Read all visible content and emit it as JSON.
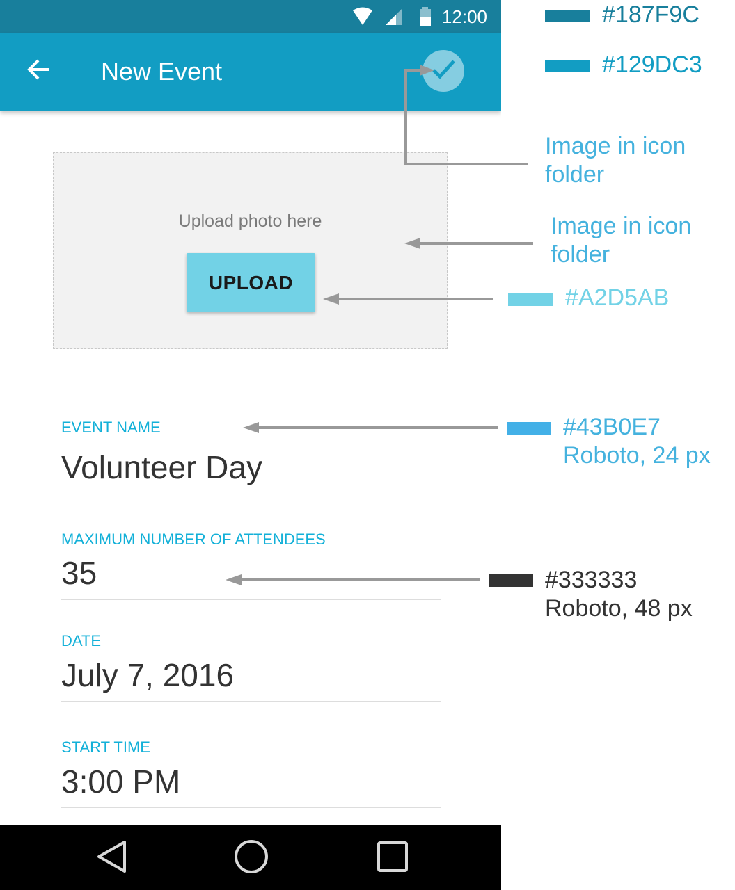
{
  "status_bar": {
    "time": "12:00"
  },
  "app_bar": {
    "title": "New Event"
  },
  "photo": {
    "hint": "Upload photo here",
    "upload_label": "UPLOAD"
  },
  "fields": [
    {
      "label": "EVENT NAME",
      "value": "Volunteer Day"
    },
    {
      "label": "MAXIMUM NUMBER OF ATTENDEES",
      "value": "35"
    },
    {
      "label": "DATE",
      "value": "July 7, 2016"
    },
    {
      "label": "START TIME",
      "value": "3:00 PM"
    }
  ],
  "annotations": {
    "status_color": {
      "swatch": "#187F9C",
      "text": "#187F9C"
    },
    "appbar_color": {
      "swatch": "#129DC3",
      "text": "#129DC3"
    },
    "check_note": [
      "Image in icon",
      "folder"
    ],
    "photo_note": [
      "Image in icon",
      "folder"
    ],
    "button_color": {
      "swatch": "#72D2E6",
      "text": "#A2D5AB"
    },
    "label_spec": {
      "swatch": "#43B0E7",
      "lines": [
        "#43B0E7",
        "Roboto, 24 px"
      ]
    },
    "value_spec": {
      "swatch": "#333333",
      "lines": [
        "#333333",
        "Roboto, 48 px"
      ]
    }
  },
  "icons": [
    "wifi-icon",
    "signal-icon",
    "battery-icon",
    "arrow-back-icon",
    "check-icon",
    "triangle-back-icon",
    "circle-home-icon",
    "square-recents-icon"
  ],
  "colors": {
    "status_bar": "#187F9C",
    "app_bar": "#129DC3",
    "upload_button": "#72D2E6",
    "label": "#12B0D8",
    "value": "#333333"
  }
}
